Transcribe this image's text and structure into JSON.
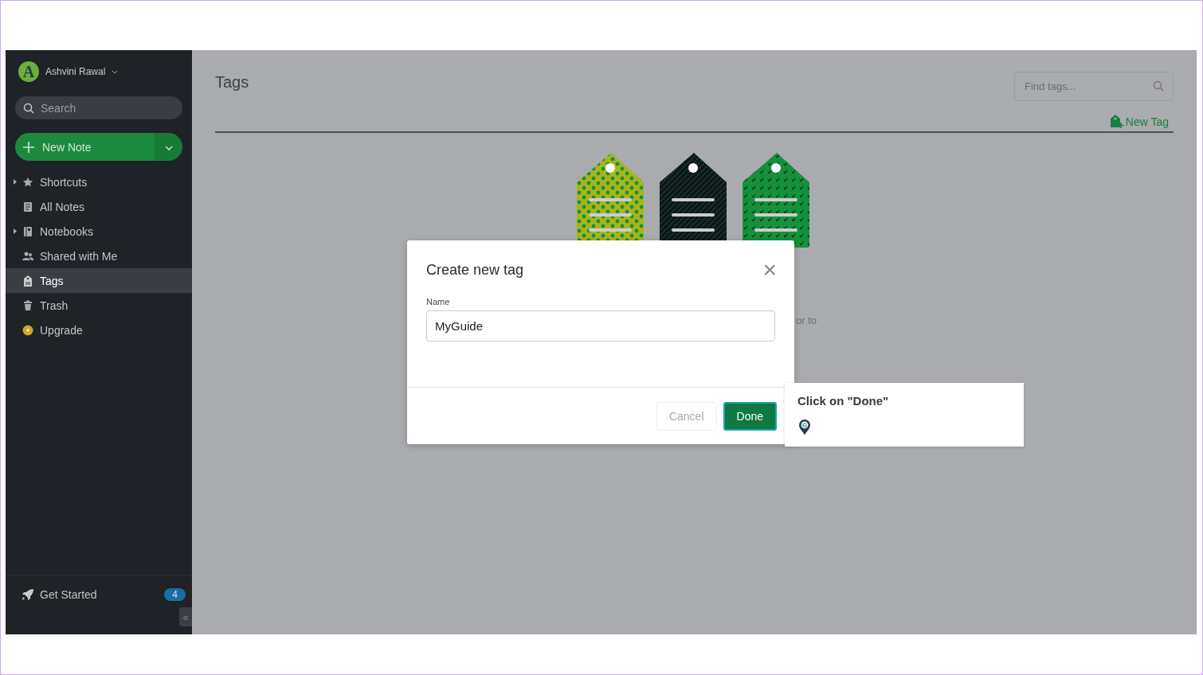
{
  "sidebar": {
    "user": {
      "name": "Ashvini Rawal",
      "initial": "A"
    },
    "search": {
      "placeholder": "Search"
    },
    "new_note": "New Note",
    "items": [
      {
        "label": "Shortcuts",
        "kind": "star",
        "expandable": true,
        "selected": false
      },
      {
        "label": "All Notes",
        "kind": "note",
        "expandable": false,
        "selected": false
      },
      {
        "label": "Notebooks",
        "kind": "notebook",
        "expandable": true,
        "selected": false
      },
      {
        "label": "Shared with Me",
        "kind": "people",
        "expandable": false,
        "selected": false
      },
      {
        "label": "Tags",
        "kind": "tag",
        "expandable": false,
        "selected": true
      },
      {
        "label": "Trash",
        "kind": "trash",
        "expandable": false,
        "selected": false
      },
      {
        "label": "Upgrade",
        "kind": "upgrade",
        "expandable": false,
        "selected": false
      }
    ],
    "get_started": {
      "label": "Get Started",
      "count": "4"
    },
    "collapse": "«"
  },
  "main": {
    "title": "Tags",
    "find": {
      "placeholder": "Find tags..."
    },
    "new_tag": "New Tag",
    "hidden_text": "or to"
  },
  "dialog": {
    "title": "Create new tag",
    "close": "×",
    "field_label": "Name",
    "field_value": "MyGuide",
    "buttons": [
      {
        "label": "Cancel",
        "kind": "secondary"
      },
      {
        "label": "Done",
        "kind": "primary"
      }
    ]
  },
  "tooltip": {
    "text": "Click on \"Done\"",
    "logo_letter": "G"
  }
}
